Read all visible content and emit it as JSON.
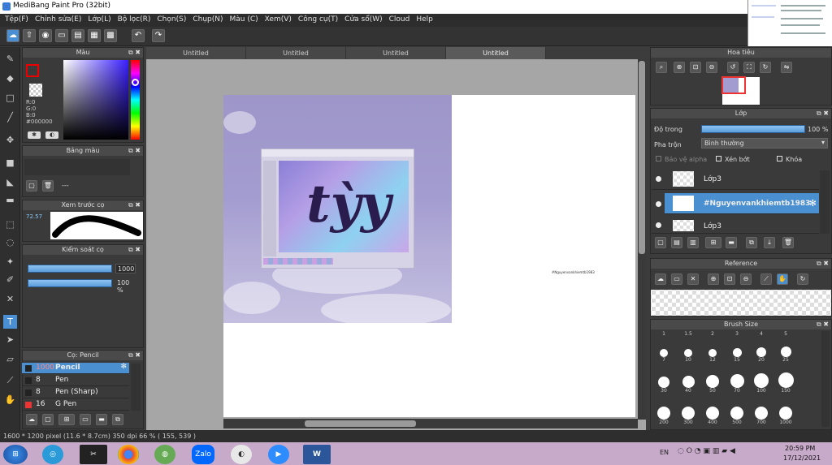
{
  "window": {
    "title": "MediBang Paint Pro (32bit)"
  },
  "menu": [
    "Tệp(F)",
    "Chỉnh sửa(E)",
    "Lớp(L)",
    "Bộ lọc(R)",
    "Chọn(S)",
    "Chụp(N)",
    "Màu (C)",
    "Xem(V)",
    "Công cụ(T)",
    "Cửa sổ(W)",
    "Cloud",
    "Help"
  ],
  "tabs": [
    "Untitled",
    "Untitled",
    "Untitled",
    "Untitled"
  ],
  "color_panel": {
    "title": "Màu",
    "r": "R:0",
    "g": "G:0",
    "b": "B:0",
    "hex": "#000000"
  },
  "palette_panel": {
    "title": "Bảng màu",
    "dash": "---"
  },
  "brush_preview": {
    "title": "Xem trước cọ",
    "value": "72.57"
  },
  "brush_control": {
    "title": "Kiểm soát cọ",
    "size": "1000",
    "opacity": "100 %"
  },
  "brush_list": {
    "title": "Cọ: Pencil",
    "items": [
      {
        "size": "1000",
        "name": "Pencil"
      },
      {
        "size": "8",
        "name": "Pen"
      },
      {
        "size": "8",
        "name": "Pen (Sharp)"
      },
      {
        "size": "16",
        "name": "G Pen"
      }
    ]
  },
  "navigator": {
    "title": "Hoa tiêu"
  },
  "layers": {
    "title": "Lớp",
    "opacity_label": "Độ trong",
    "opacity_value": "100 %",
    "blend_label": "Pha trộn",
    "blend_value": "Bình thường",
    "protect_alpha": "Bảo vệ alpha",
    "clip": "Xén bớt",
    "lock": "Khóa",
    "items": [
      {
        "name": "Lớp3"
      },
      {
        "name": "#Nguyenvankhiemtb1983"
      },
      {
        "name": "Lớp3"
      }
    ]
  },
  "reference": {
    "title": "Reference"
  },
  "brush_size": {
    "title": "Brush Size",
    "labels": [
      "1",
      "1.5",
      "2",
      "3",
      "4",
      "5",
      "7",
      "10",
      "12",
      "15",
      "20",
      "25",
      "30",
      "40",
      "50",
      "70",
      "100",
      "150",
      "200",
      "300",
      "400",
      "500",
      "700",
      "1000"
    ]
  },
  "artwork": {
    "text": "tỳy",
    "small_text": "#Nguyenvankhiemtb1983"
  },
  "status": {
    "text": "1600 * 1200 pixel  (11.6 * 8.7cm)  350 dpi  66 %  ( 155, 539 )"
  },
  "taskbar": {
    "lang": "EN",
    "time": "20:59 PM",
    "date": "17/12/2021",
    "zalo": "Zalo"
  },
  "colors": {
    "accent": "#4a90d0",
    "panel": "#3a3a3a",
    "taskbar": "#c7a9c9"
  }
}
